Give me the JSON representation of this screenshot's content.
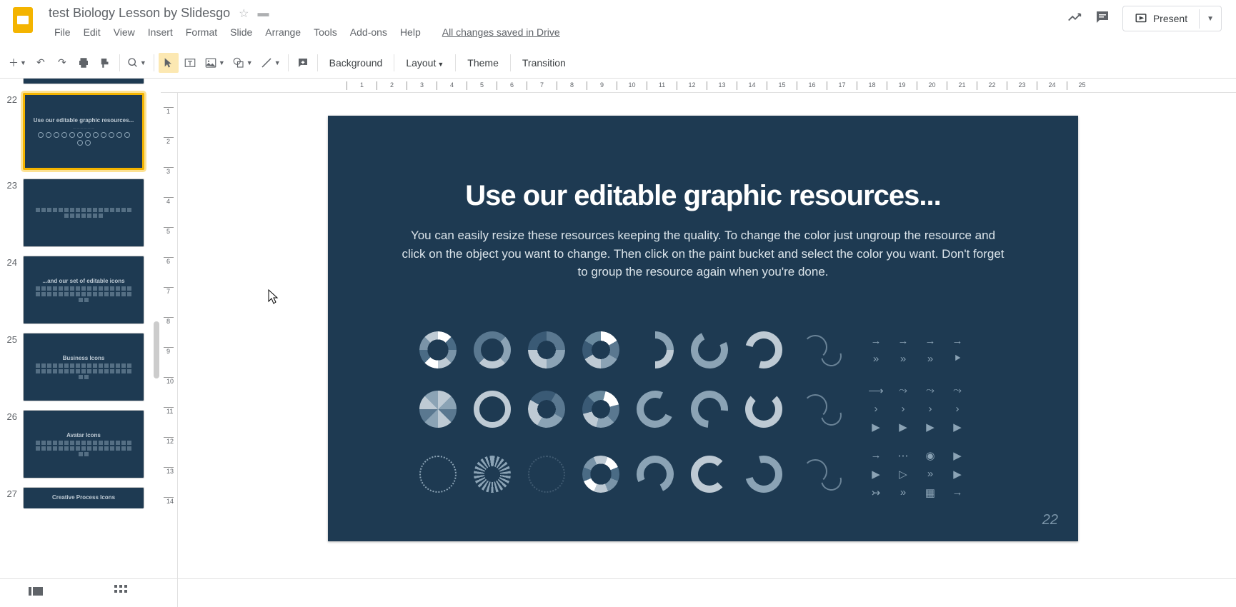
{
  "doc_title": "test Biology Lesson by Slidesgo",
  "saved_status": "All changes saved in Drive",
  "menu": {
    "file": "File",
    "edit": "Edit",
    "view": "View",
    "insert": "Insert",
    "format": "Format",
    "slide": "Slide",
    "arrange": "Arrange",
    "tools": "Tools",
    "addons": "Add-ons",
    "help": "Help"
  },
  "present_label": "Present",
  "toolbar": {
    "background": "Background",
    "layout": "Layout",
    "theme": "Theme",
    "transition": "Transition"
  },
  "ruler_h": [
    "1",
    "2",
    "3",
    "4",
    "5",
    "6",
    "7",
    "8",
    "9",
    "10",
    "11",
    "12",
    "13",
    "14",
    "15",
    "16",
    "17",
    "18",
    "19",
    "20",
    "21",
    "22",
    "23",
    "24",
    "25"
  ],
  "ruler_v": [
    "1",
    "2",
    "3",
    "4",
    "5",
    "6",
    "7",
    "8",
    "9",
    "10",
    "11",
    "12",
    "13",
    "14"
  ],
  "slides": [
    {
      "num": "22",
      "title": "Use our editable graphic resources...",
      "selected": true
    },
    {
      "num": "23",
      "title": ""
    },
    {
      "num": "24",
      "title": "...and our set of editable icons"
    },
    {
      "num": "25",
      "title": "Business Icons"
    },
    {
      "num": "26",
      "title": "Avatar Icons"
    },
    {
      "num": "27",
      "title": "Creative Process Icons"
    }
  ],
  "current_slide": {
    "title": "Use our editable graphic resources...",
    "body": "You can easily resize these resources keeping the quality. To change the color just ungroup the resource and click on the object you want to change. Then click on the paint bucket and select the color you want. Don't forget to group the resource again when you're done.",
    "page_number": "22"
  }
}
